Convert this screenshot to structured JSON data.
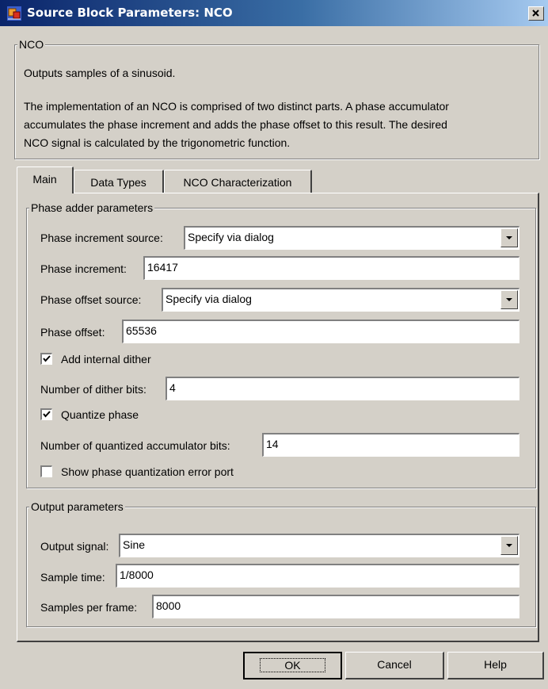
{
  "window": {
    "title": "Source Block Parameters: NCO",
    "close_label": "×"
  },
  "description": {
    "group_title": "NCO",
    "line1": "Outputs samples of a sinusoid.",
    "line2": "The implementation of an NCO is comprised of two distinct parts. A phase accumulator",
    "line3": "accumulates the phase increment and adds the phase offset to this result. The desired",
    "line4": "NCO signal is calculated by the trigonometric function."
  },
  "tabs": [
    {
      "label": "Main",
      "active": true
    },
    {
      "label": "Data Types",
      "active": false
    },
    {
      "label": "NCO Characterization",
      "active": false
    }
  ],
  "phase_adder": {
    "group_title": "Phase adder parameters",
    "increment_source_label": "Phase increment source:",
    "increment_source_value": "Specify via dialog",
    "increment_label": "Phase increment:",
    "increment_value": "16417",
    "offset_source_label": "Phase offset source:",
    "offset_source_value": "Specify via dialog",
    "offset_label": "Phase offset:",
    "offset_value": "65536",
    "dither_checkbox_label": "Add internal dither",
    "dither_checked": true,
    "dither_bits_label": "Number of dither bits:",
    "dither_bits_value": "4",
    "quantize_checkbox_label": "Quantize phase",
    "quantize_checked": true,
    "quantized_bits_label": "Number of quantized accumulator bits:",
    "quantized_bits_value": "14",
    "error_port_checkbox_label": "Show phase quantization error port",
    "error_port_checked": false
  },
  "output": {
    "group_title": "Output parameters",
    "signal_label": "Output signal:",
    "signal_value": "Sine",
    "sample_time_label": "Sample time:",
    "sample_time_value": "1/8000",
    "samples_per_frame_label": "Samples per frame:",
    "samples_per_frame_value": "8000"
  },
  "buttons": {
    "ok": "OK",
    "cancel": "Cancel",
    "help": "Help"
  },
  "colors": {
    "titlebar_start": "#0a246a",
    "titlebar_end": "#a6caf0",
    "face": "#d4d0c8"
  }
}
